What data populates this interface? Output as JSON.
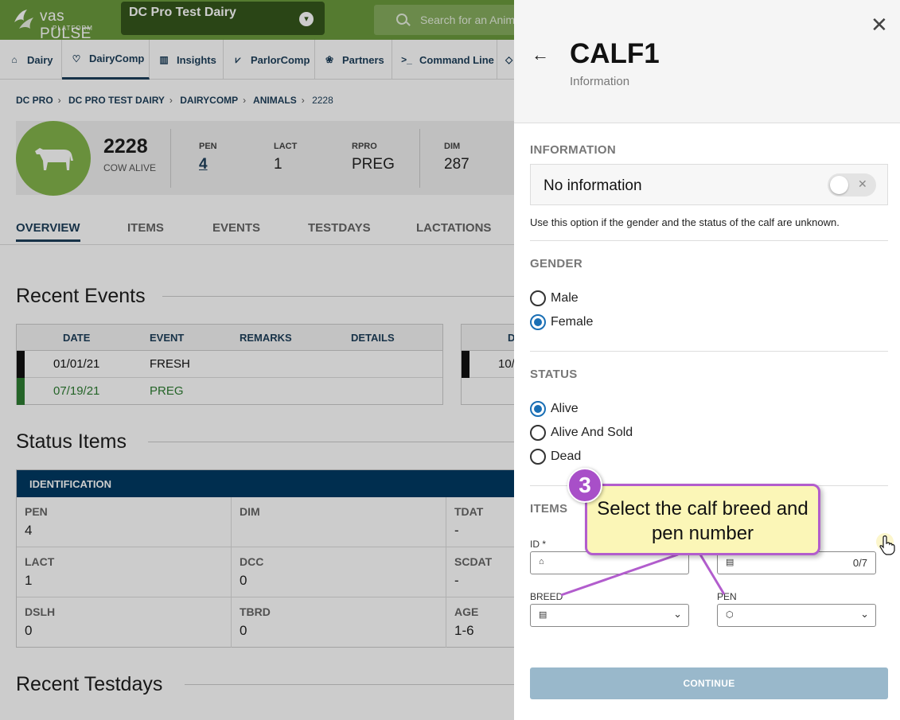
{
  "app": {
    "brand": "vas PULSE",
    "brand_sub": "PLATFORM",
    "dairy_selector": "DC Pro Test Dairy",
    "search_placeholder": "Search for an Anima"
  },
  "nav": {
    "items": [
      {
        "label": "Dairy",
        "icon": "home-icon"
      },
      {
        "label": "DairyComp",
        "icon": "cow-icon"
      },
      {
        "label": "Insights",
        "icon": "chart-icon"
      },
      {
        "label": "ParlorComp",
        "icon": "parlor-icon"
      },
      {
        "label": "Partners",
        "icon": "partners-icon"
      },
      {
        "label": "Command Line",
        "icon": "terminal-icon"
      }
    ]
  },
  "breadcrumb": [
    "DC PRO",
    "DC PRO TEST DAIRY",
    "DAIRYCOMP",
    "ANIMALS",
    "2228"
  ],
  "animal": {
    "id": "2228",
    "status": "COW ALIVE",
    "stats": [
      {
        "label": "PEN",
        "value": "4"
      },
      {
        "label": "LACT",
        "value": "1"
      },
      {
        "label": "RPRO",
        "value": "PREG"
      },
      {
        "label": "DIM",
        "value": "287"
      }
    ]
  },
  "tabs": [
    "OVERVIEW",
    "ITEMS",
    "EVENTS",
    "TESTDAYS",
    "LACTATIONS"
  ],
  "recent_events": {
    "title": "Recent Events",
    "columns": [
      "DATE",
      "EVENT",
      "REMARKS",
      "DETAILS"
    ],
    "rows": [
      {
        "date": "01/01/21",
        "event": "FRESH",
        "color": "#111111"
      },
      {
        "date": "07/19/21",
        "event": "PREG",
        "color": "#2e7d32"
      }
    ],
    "second_table_header": "D",
    "second_table_cell": "10/"
  },
  "status_items": {
    "title": "Status Items",
    "group": "IDENTIFICATION",
    "items": [
      {
        "label": "PEN",
        "value": "4"
      },
      {
        "label": "DIM",
        "value": ""
      },
      {
        "label": "TDAT",
        "value": "-"
      },
      {
        "label": "LACT",
        "value": "1"
      },
      {
        "label": "DCC",
        "value": "0"
      },
      {
        "label": "SCDAT",
        "value": "-"
      },
      {
        "label": "DSLH",
        "value": "0"
      },
      {
        "label": "TBRD",
        "value": "0"
      },
      {
        "label": "AGE",
        "value": "1-6"
      }
    ]
  },
  "recent_testdays": {
    "title": "Recent Testdays"
  },
  "panel": {
    "title": "CALF1",
    "subtitle": "Information",
    "information_section": "INFORMATION",
    "no_info_label": "No information",
    "no_info_on": false,
    "no_info_help": "Use this option if the gender and the status of the calf are unknown.",
    "gender_section": "GENDER",
    "gender_options": [
      "Male",
      "Female"
    ],
    "gender_selected": "Female",
    "status_section": "STATUS",
    "status_options": [
      "Alive",
      "Alive And Sold",
      "Dead"
    ],
    "status_selected": "Alive",
    "items_section": "ITEMS",
    "id_label": "ID *",
    "id_value": "",
    "count_value": "",
    "count_counter": "0/7",
    "breed_label": "BREED",
    "pen_label": "PEN",
    "continue_label": "CONTINUE"
  },
  "callout": {
    "step": "3",
    "text": "Select the calf breed and pen number",
    "colors": {
      "border": "#b25dcd",
      "fill": "#fbf6b7"
    }
  },
  "colors": {
    "brand_green": "#6b9a3c",
    "nav_blue": "#1d3f5a",
    "accent_blue": "#1a6fb5",
    "status_header": "#003a63",
    "continue_disabled": "#99b8cb"
  }
}
